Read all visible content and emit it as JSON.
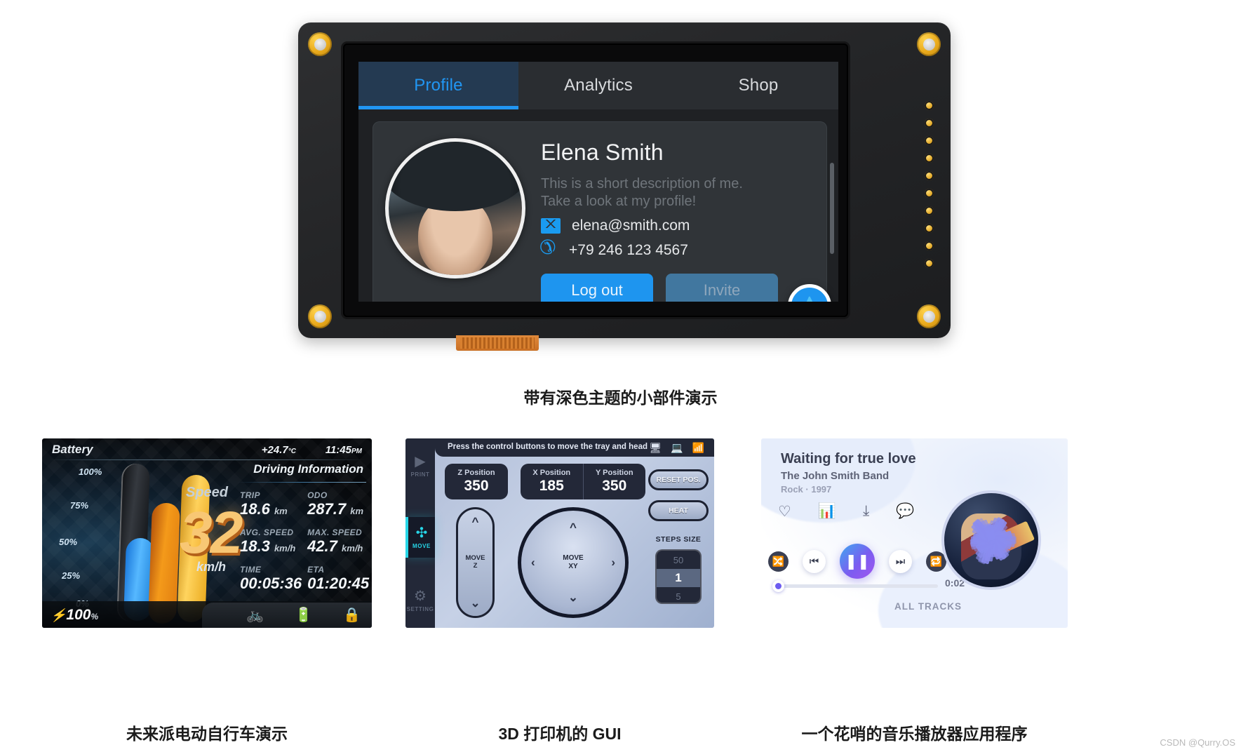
{
  "captions": {
    "main": "带有深色主题的小部件演示",
    "bike": "未来派电动自行车演示",
    "printer": "3D 打印机的 GUI",
    "music": "一个花哨的音乐播放器应用程序"
  },
  "watermark": "CSDN @Qurry.OS",
  "devboard": {
    "tabs": [
      {
        "label": "Profile",
        "active": true
      },
      {
        "label": "Analytics",
        "active": false
      },
      {
        "label": "Shop",
        "active": false
      }
    ],
    "profile": {
      "name": "Elena Smith",
      "description": "This is a short description of me.\nTake a look at my profile!",
      "email": "elena@smith.com",
      "phone": "+79 246 123 4567",
      "mail_icon": "mail-icon",
      "phone_icon": "phone-icon",
      "logout_label": "Log out",
      "invite_label": "Invite",
      "fab_icon": "droplet-icon",
      "accent": "#1e95ef"
    }
  },
  "bike": {
    "battery_label": "Battery",
    "scale": [
      "100%",
      "75%",
      "50%",
      "25%",
      "0%"
    ],
    "temperature": "+24.7",
    "temperature_unit": "°C",
    "clock": "11:45",
    "clock_meridiem": "PM",
    "speed_label": "Speed",
    "speed_value": "32",
    "speed_unit": "km/h",
    "driving_info_title": "Driving Information",
    "stats": [
      {
        "key": "TRIP",
        "value": "18.6",
        "unit": "km"
      },
      {
        "key": "ODO",
        "value": "287.7",
        "unit": "km"
      },
      {
        "key": "AVG. SPEED",
        "value": "18.3",
        "unit": "km/h"
      },
      {
        "key": "MAX. SPEED",
        "value": "42.7",
        "unit": "km/h"
      },
      {
        "key": "TIME",
        "value": "00:05:36",
        "unit": ""
      },
      {
        "key": "ETA",
        "value": "01:20:45",
        "unit": ""
      }
    ],
    "battery_percent": "100",
    "battery_percent_unit": "%",
    "bolt_icon": "bolt-icon",
    "bottom_icons": [
      "bicycle-icon",
      "battery-charging-icon",
      "lock-icon"
    ]
  },
  "printer": {
    "hint": "Press the control buttons to move the tray and head",
    "sidebar": [
      {
        "label": "PRINT",
        "icon": "play-icon"
      },
      {
        "label": "MOVE",
        "icon": "move-arrows-icon"
      },
      {
        "label": "SETTING",
        "icon": "gear-icon"
      }
    ],
    "status_icons": [
      "display-icon",
      "monitor-icon",
      "wifi-icon"
    ],
    "positions": [
      {
        "label": "Z Position",
        "value": "350"
      },
      {
        "label": "X Position",
        "value": "185"
      },
      {
        "label": "Y Position",
        "value": "350"
      }
    ],
    "z_control_label": "MOVE\nZ",
    "xy_control_label": "MOVE\nXY",
    "reset_label": "RESET POS.",
    "heat_label": "HEAT",
    "steps_size_label": "STEPS SIZE",
    "steps_options": [
      "50",
      "1",
      "5"
    ],
    "steps_selected": "1",
    "accent": "#27d6e8"
  },
  "music": {
    "title": "Waiting for true love",
    "artist": "The John Smith Band",
    "genre": "Rock · 1997",
    "action_icons": [
      "heart-icon",
      "equalizer-icon",
      "download-icon",
      "comment-icon"
    ],
    "controls": [
      "shuffle-icon",
      "previous-icon",
      "pause-icon",
      "next-icon",
      "repeat-icon"
    ],
    "elapsed": "0:02",
    "all_tracks_label": "ALL TRACKS",
    "accent": "#6d5cf0"
  }
}
